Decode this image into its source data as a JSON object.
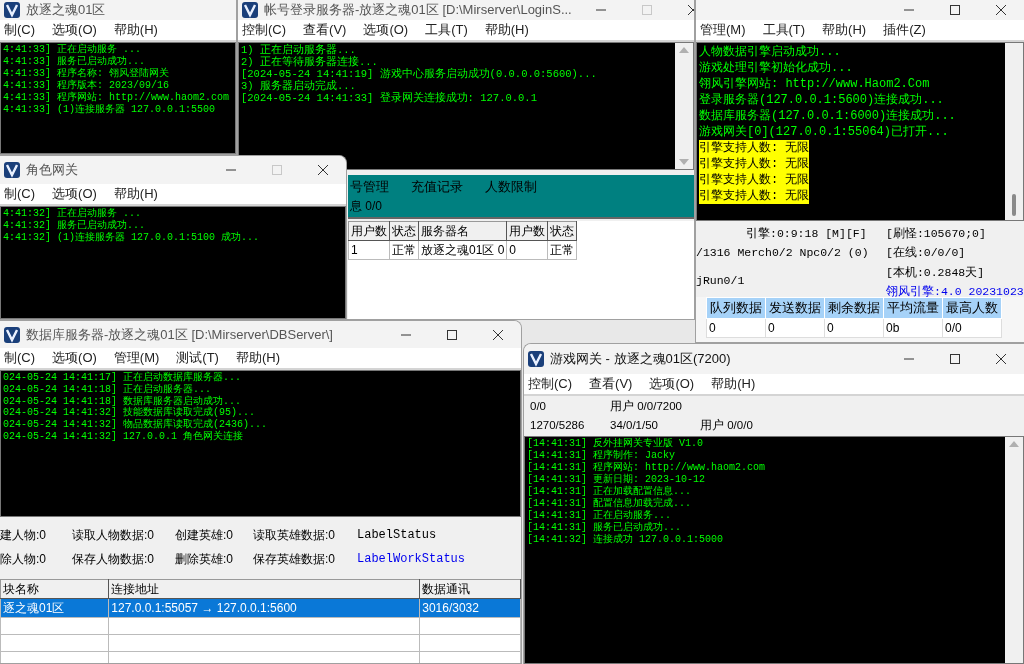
{
  "windows": [
    {
      "title": "放逐之魂01区",
      "icon": true,
      "menu": [
        "制(C)",
        "选项(O)",
        "帮助(H)"
      ],
      "parts": [
        {
          "kind": "console",
          "lines": [
            {
              "text": "4:41:33] 正在启动服务 ..."
            },
            {
              "text": "4:41:33] 服务已启动成功..."
            },
            {
              "text": "4:41:33] 程序名称: 翎风登陆网关"
            },
            {
              "text": "4:41:33] 程序版本: 2023/09/16"
            },
            {
              "text": "4:41:33] 程序网站: http://www.haom2.com"
            },
            {
              "text": "4:41:33] (1)连接服务器 127.0.0.1:5500"
            }
          ]
        }
      ]
    },
    {
      "title": "帐号登录服务器-放逐之魂01区  [D:\\Mirserver\\LoginS...",
      "icon": true,
      "controls": true,
      "maximize_disabled": true,
      "menu": [
        "控制(C)",
        "查看(V)",
        "选项(O)",
        "工具(T)",
        "帮助(H)"
      ],
      "parts": [
        {
          "kind": "console",
          "lines": [
            {
              "text": "1) 正在启动服务器..."
            },
            {
              "text": "2) 正在等待服务器连接..."
            },
            {
              "text": "[2024-05-24 14:41:19] 游戏中心服务启动成功(0.0.0.0:5600)..."
            },
            {
              "text": "3) 服务器启动完成..."
            },
            {
              "text": "[2024-05-24 14:41:33] 登录网关连接成功: 127.0.0.1"
            }
          ]
        },
        {
          "kind": "panel",
          "tabs": [
            "号管理",
            "充值记录",
            "人数限制"
          ],
          "info": "息 0/0"
        },
        {
          "kind": "grid",
          "columns": [
            "用户数",
            "状态",
            "服务器名",
            "用户数",
            "状态"
          ],
          "rows": [
            {
              "cells": [
                "1",
                "正常",
                "放逐之魂01区 0",
                "0",
                "正常"
              ]
            }
          ]
        }
      ]
    },
    {
      "controls": true,
      "maximize_disabled": false,
      "menu": [
        "管理(M)",
        "工具(T)",
        "帮助(H)",
        "插件(Z)"
      ],
      "parts": [
        {
          "kind": "console",
          "lines": [
            {
              "text": "人物数据引擎启动成功...",
              "highlighted": false
            },
            {
              "text": "游戏处理引擎初始化成功...",
              "highlighted": false
            },
            {
              "text": "翎风引擎网站: http://www.Haom2.Com",
              "highlighted": false
            },
            {
              "text": "登录服务器(127.0.0.1:5600)连接成功...",
              "highlighted": false
            },
            {
              "text": "数据库服务器(127.0.0.1:6000)连接成功...",
              "highlighted": false
            },
            {
              "text": "游戏网关[0](127.0.0.1:55064)已打开...",
              "highlighted": false
            },
            {
              "text": "引擎支持人数: 无限",
              "highlighted": true
            },
            {
              "text": "引擎支持人数: 无限",
              "highlighted": true
            },
            {
              "text": "引擎支持人数: 无限",
              "highlighted": true
            },
            {
              "text": "引擎支持人数: 无限",
              "highlighted": true
            }
          ]
        },
        {
          "kind": "columns",
          "columns": [
            [
              {
                "text": "引擎:0:9:18 [M][F]"
              },
              {
                "text": "/1316 Merch0/2 Npc0/2 (0)"
              },
              {
                "text": "jRun0/1"
              }
            ],
            [
              {
                "text": "[刷怪:105670;0]"
              },
              {
                "text": "[在线:0/0/0]"
              },
              {
                "text": "[本机:0.2848天]"
              },
              {
                "text": "翎风引擎:4.0 20231023",
                "accent": true
              }
            ]
          ]
        },
        {
          "kind": "grid",
          "columns": [
            "队列数据",
            "发送数据",
            "剩余数据",
            "平均流量",
            "最高人数"
          ],
          "rows": [
            {
              "cells": [
                "0",
                "0",
                "0",
                "0b",
                "0/0"
              ]
            }
          ]
        }
      ]
    },
    {
      "title": "角色网关",
      "icon": true,
      "controls": true,
      "maximize_disabled": true,
      "menu": [
        "制(C)",
        "选项(O)",
        "帮助(H)"
      ],
      "parts": [
        {
          "kind": "console",
          "lines": [
            {
              "text": "4:41:32] 正在启动服务 ..."
            },
            {
              "text": "4:41:32] 服务已启动成功..."
            },
            {
              "text": "4:41:32] (1)连接服务器 127.0.0.1:5100 成功..."
            }
          ]
        }
      ]
    },
    {
      "title": "数据库服务器-放逐之魂01区  [D:\\Mirserver\\DBServer\\]",
      "icon": true,
      "controls": true,
      "maximize_disabled": false,
      "menu": [
        "制(C)",
        "选项(O)",
        "管理(M)",
        "测试(T)",
        "帮助(H)"
      ],
      "parts": [
        {
          "kind": "console",
          "lines": [
            {
              "text": "024-05-24 14:41:17] 正在启动数据库服务器..."
            },
            {
              "text": "024-05-24 14:41:18] 正在启动服务器..."
            },
            {
              "text": "024-05-24 14:41:18] 数据库服务器启动成功..."
            },
            {
              "text": "024-05-24 14:41:32] 技能数据库读取完成(95)..."
            },
            {
              "text": "024-05-24 14:41:32] 物品数据库读取完成(2436)..."
            },
            {
              "text": "024-05-24 14:41:32] 127.0.0.1 角色网关连接"
            }
          ]
        },
        {
          "kind": "stats",
          "rows": [
            [
              {
                "text": "建人物:0"
              },
              {
                "text": "读取人物数据:0"
              },
              {
                "text": "创建英雄:0"
              },
              {
                "text": "读取英雄数据:0"
              },
              {
                "text": "LabelStatus",
                "accent": false
              }
            ],
            [
              {
                "text": "除人物:0"
              },
              {
                "text": "保存人物数据:0"
              },
              {
                "text": "删除英雄:0"
              },
              {
                "text": "保存英雄数据:0"
              },
              {
                "text": "LabelWorkStatus",
                "accent": true
              }
            ]
          ]
        },
        {
          "kind": "grid",
          "columns": [
            "块名称",
            "连接地址",
            "数据通讯"
          ],
          "rows": [
            {
              "cells": [
                "逐之魂01区",
                "127.0.0.1:55057 → 127.0.0.1:5600",
                "3016/3032"
              ],
              "selected": true
            }
          ]
        }
      ]
    },
    {
      "title": "游戏网关 - 放逐之魂01区(7200)",
      "icon": true,
      "controls": true,
      "maximize_disabled": false,
      "menu": [
        "控制(C)",
        "查看(V)",
        "选项(O)",
        "帮助(H)"
      ],
      "parts": [
        {
          "kind": "stats",
          "rows": [
            [
              {
                "text": "0/0"
              },
              {
                "text": "用户 0/0/7200"
              }
            ],
            [
              {
                "text": "1270/5286"
              },
              {
                "text": "34/0/1/50"
              },
              {
                "text": "用户 0/0/0"
              }
            ]
          ]
        },
        {
          "kind": "console",
          "lines": [
            {
              "text": "[14:41:31] 反外挂网关专业版 V1.0"
            },
            {
              "text": "[14:41:31] 程序制作: Jacky"
            },
            {
              "text": "[14:41:31] 程序网站: http://www.haom2.com"
            },
            {
              "text": "[14:41:31] 更新日期: 2023-10-12"
            },
            {
              "text": "[14:41:31] 正在加载配置信息..."
            },
            {
              "text": "[14:41:31] 配置信息加载完成..."
            },
            {
              "text": "[14:41:31] 正在启动服务..."
            },
            {
              "text": "[14:41:31] 服务已启动成功..."
            },
            {
              "text": "[14:41:32] 连接成功 127.0.0.1:5000"
            }
          ]
        }
      ]
    }
  ]
}
